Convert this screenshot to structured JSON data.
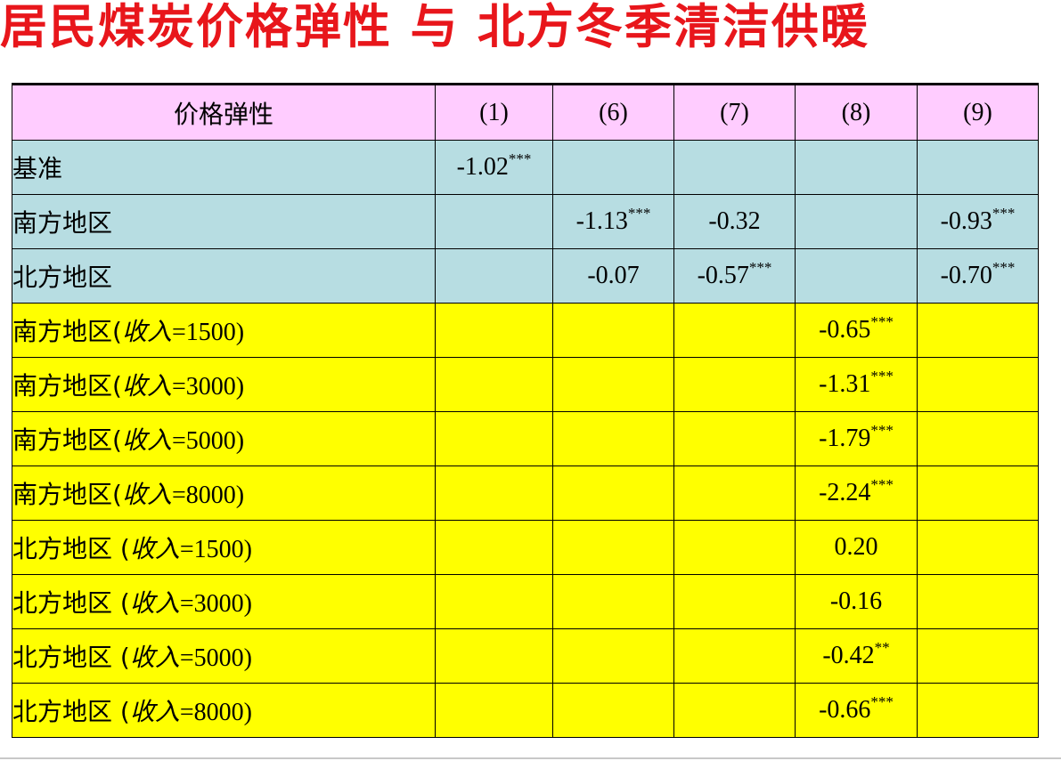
{
  "title": "居民煤炭价格弹性 与 北方冬季清洁供暖",
  "table": {
    "header": {
      "label": "价格弹性",
      "cols": [
        "(1)",
        "(6)",
        "(7)",
        "(8)",
        "(9)"
      ]
    },
    "rows": [
      {
        "label": "基准",
        "income": "",
        "group": "blue",
        "cells": [
          {
            "v": "-1.02",
            "s": "***"
          },
          {
            "v": "",
            "s": ""
          },
          {
            "v": "",
            "s": ""
          },
          {
            "v": "",
            "s": ""
          },
          {
            "v": "",
            "s": ""
          }
        ]
      },
      {
        "label": "南方地区",
        "income": "",
        "group": "blue",
        "cells": [
          {
            "v": "",
            "s": ""
          },
          {
            "v": "-1.13",
            "s": "***"
          },
          {
            "v": "-0.32",
            "s": ""
          },
          {
            "v": "",
            "s": ""
          },
          {
            "v": "-0.93",
            "s": "***"
          }
        ]
      },
      {
        "label": "北方地区",
        "income": "",
        "group": "blue",
        "cells": [
          {
            "v": "",
            "s": ""
          },
          {
            "v": "-0.07",
            "s": ""
          },
          {
            "v": "-0.57",
            "s": "***"
          },
          {
            "v": "",
            "s": ""
          },
          {
            "v": "-0.70",
            "s": "***"
          }
        ]
      },
      {
        "label": "南方地区(",
        "income_label": "收入",
        "income": "=1500)",
        "group": "yellow",
        "cells": [
          {
            "v": "",
            "s": ""
          },
          {
            "v": "",
            "s": ""
          },
          {
            "v": "",
            "s": ""
          },
          {
            "v": "-0.65",
            "s": "***"
          },
          {
            "v": "",
            "s": ""
          }
        ]
      },
      {
        "label": "南方地区(",
        "income_label": "收入",
        "income": "=3000)",
        "group": "yellow",
        "cells": [
          {
            "v": "",
            "s": ""
          },
          {
            "v": "",
            "s": ""
          },
          {
            "v": "",
            "s": ""
          },
          {
            "v": "-1.31",
            "s": "***"
          },
          {
            "v": "",
            "s": ""
          }
        ]
      },
      {
        "label": "南方地区(",
        "income_label": "收入",
        "income": "=5000)",
        "group": "yellow",
        "cells": [
          {
            "v": "",
            "s": ""
          },
          {
            "v": "",
            "s": ""
          },
          {
            "v": "",
            "s": ""
          },
          {
            "v": "-1.79",
            "s": "***"
          },
          {
            "v": "",
            "s": ""
          }
        ]
      },
      {
        "label": "南方地区(",
        "income_label": "收入",
        "income": "=8000)",
        "group": "yellow",
        "cells": [
          {
            "v": "",
            "s": ""
          },
          {
            "v": "",
            "s": ""
          },
          {
            "v": "",
            "s": ""
          },
          {
            "v": "-2.24",
            "s": "***"
          },
          {
            "v": "",
            "s": ""
          }
        ]
      },
      {
        "label": "北方地区 (",
        "income_label": "收入",
        "income": "=1500)",
        "group": "yellow",
        "cells": [
          {
            "v": "",
            "s": ""
          },
          {
            "v": "",
            "s": ""
          },
          {
            "v": "",
            "s": ""
          },
          {
            "v": "0.20",
            "s": ""
          },
          {
            "v": "",
            "s": ""
          }
        ]
      },
      {
        "label": "北方地区 (",
        "income_label": "收入",
        "income": "=3000)",
        "group": "yellow",
        "cells": [
          {
            "v": "",
            "s": ""
          },
          {
            "v": "",
            "s": ""
          },
          {
            "v": "",
            "s": ""
          },
          {
            "v": "-0.16",
            "s": ""
          },
          {
            "v": "",
            "s": ""
          }
        ]
      },
      {
        "label": "北方地区 (",
        "income_label": "收入",
        "income": "=5000)",
        "group": "yellow",
        "cells": [
          {
            "v": "",
            "s": ""
          },
          {
            "v": "",
            "s": ""
          },
          {
            "v": "",
            "s": ""
          },
          {
            "v": "-0.42",
            "s": "**"
          },
          {
            "v": "",
            "s": ""
          }
        ]
      },
      {
        "label": "北方地区 (",
        "income_label": "收入",
        "income": "=8000)",
        "group": "yellow",
        "cells": [
          {
            "v": "",
            "s": ""
          },
          {
            "v": "",
            "s": ""
          },
          {
            "v": "",
            "s": ""
          },
          {
            "v": "-0.66",
            "s": "***"
          },
          {
            "v": "",
            "s": ""
          }
        ]
      }
    ]
  },
  "colors": {
    "title": "#e8161b",
    "header_bg": "#ffccff",
    "blue_bg": "#b7dde2",
    "yellow_bg": "#ffff00"
  }
}
